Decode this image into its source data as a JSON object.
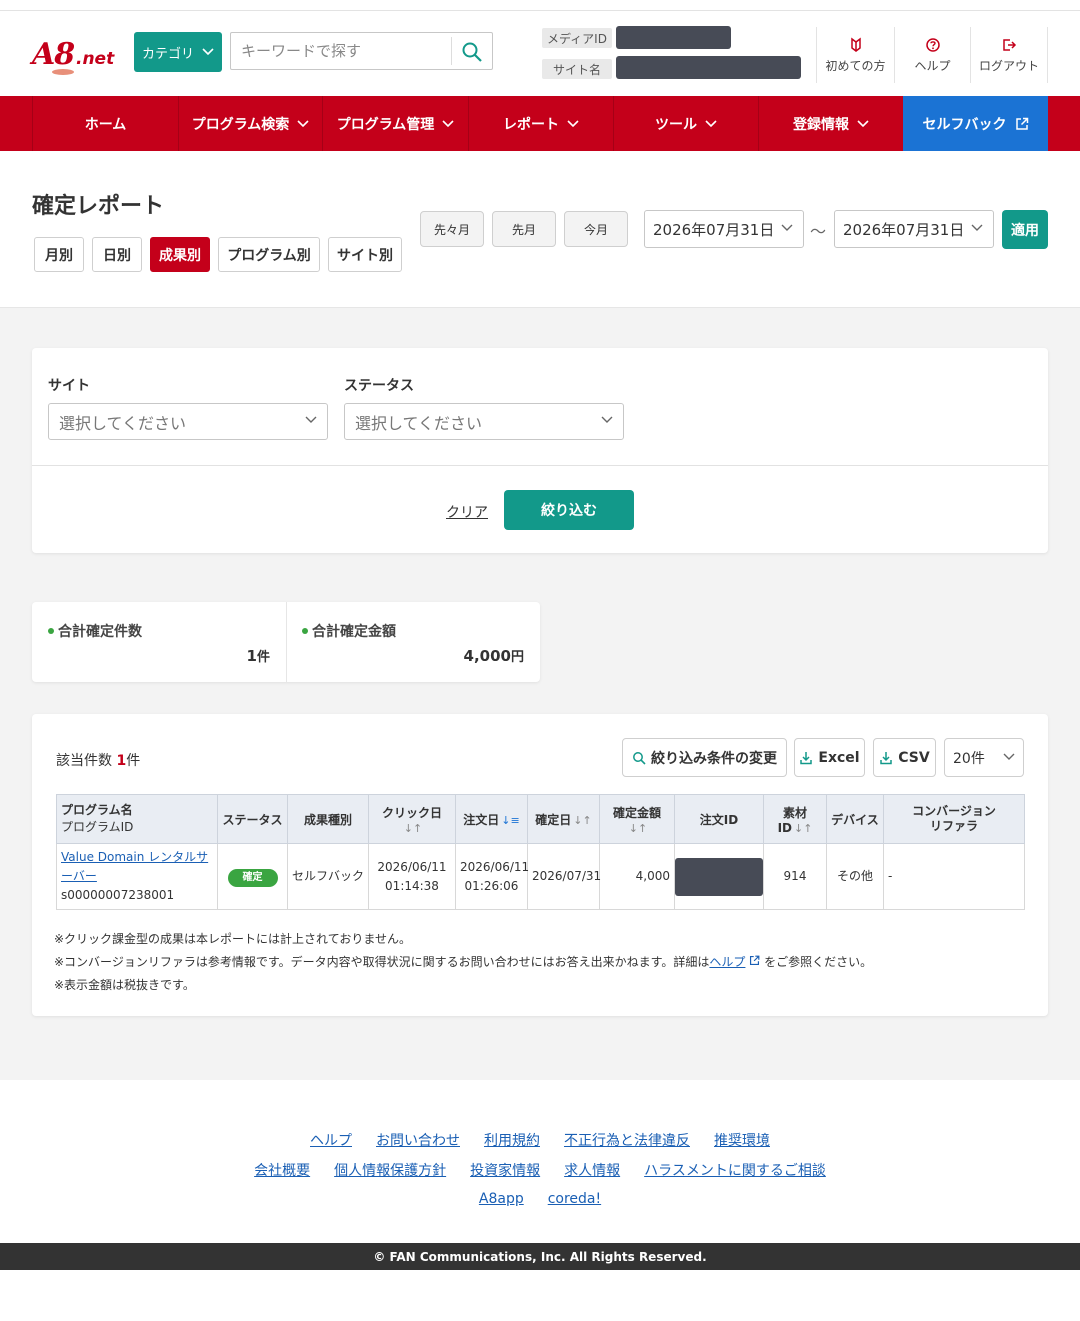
{
  "header": {
    "logo_main": "A8",
    "logo_sub": ".net",
    "category_label": "カテゴリ",
    "search_placeholder": "キーワードで探す",
    "media_id_label": "メディアID",
    "site_name_label": "サイト名",
    "links": [
      "初めての方",
      "ヘルプ",
      "ログアウト"
    ]
  },
  "nav": {
    "items": [
      "ホーム",
      "プログラム検索",
      "プログラム管理",
      "レポート",
      "ツール",
      "登録情報",
      "セルフバック"
    ]
  },
  "page": {
    "title": "確定レポート",
    "tabs": [
      "月別",
      "日別",
      "成果別",
      "プログラム別",
      "サイト別"
    ],
    "active_tab": "成果別",
    "period_buttons": [
      "先々月",
      "先月",
      "今月"
    ],
    "date_from": "2026年07月31日",
    "date_to": "2026年07月31日",
    "tilde": "～",
    "apply_label": "適用"
  },
  "filter": {
    "site_label": "サイト",
    "status_label": "ステータス",
    "site_placeholder": "選択してください",
    "status_placeholder": "選択してください",
    "clear_label": "クリア",
    "submit_label": "絞り込む"
  },
  "summary": {
    "count_label": "合計確定件数",
    "count_value": "1",
    "count_unit": "件",
    "amount_label": "合計確定金額",
    "amount_value": "4,000",
    "amount_unit": "円"
  },
  "results": {
    "count_prefix": "該当件数 ",
    "count": "1",
    "count_suffix": "件",
    "change_filter_label": "絞り込み条件の変更",
    "excel_label": "Excel",
    "csv_label": "CSV",
    "per_page": "20件",
    "columns": {
      "program_name": "プログラム名",
      "program_id": "プログラムID",
      "status": "ステータス",
      "type": "成果種別",
      "click_date": "クリック日",
      "order_date": "注文日",
      "confirm_date": "確定日",
      "amount": "確定金額",
      "order_id": "注文ID",
      "material_id": "素材ID",
      "device": "デバイス",
      "referrer_1": "コンバージョン",
      "referrer_2": "リファラ"
    },
    "rows": [
      {
        "program_name": "Value Domain レンタルサーバー",
        "program_id": "s00000007238001",
        "status": "確定",
        "type": "セルフバック",
        "click_date": "2026/06/11",
        "click_time": "01:14:38",
        "order_date": "2026/06/11",
        "order_time": "01:26:06",
        "confirm_date": "2026/07/31",
        "amount": "4,000",
        "material_id": "914",
        "device": "その他",
        "referrer": "-"
      }
    ],
    "notes": [
      "※クリック課金型の成果は本レポートには計上されておりません。",
      "※コンバージョンリファラは参考情報です。データ内容や取得状況に関するお問い合わせにはお答え出来かねます。詳細は",
      "ヘルプ",
      "をご参照ください。",
      "※表示金額は税抜きです。"
    ]
  },
  "footer": {
    "row1": [
      "ヘルプ",
      "お問い合わせ",
      "利用規約",
      "不正行為と法律違反",
      "推奨環境"
    ],
    "row2": [
      "会社概要",
      "個人情報保護方針",
      "投資家情報",
      "求人情報",
      "ハラスメントに関するご相談"
    ],
    "row3": [
      "A8app",
      "coreda!"
    ],
    "copyright": "© FAN Communications, Inc. All Rights Reserved."
  },
  "colors": {
    "brand_red": "#c4001a",
    "accent_teal": "#12998a",
    "selfback_blue": "#1b73d4",
    "status_green": "#3aa541"
  }
}
